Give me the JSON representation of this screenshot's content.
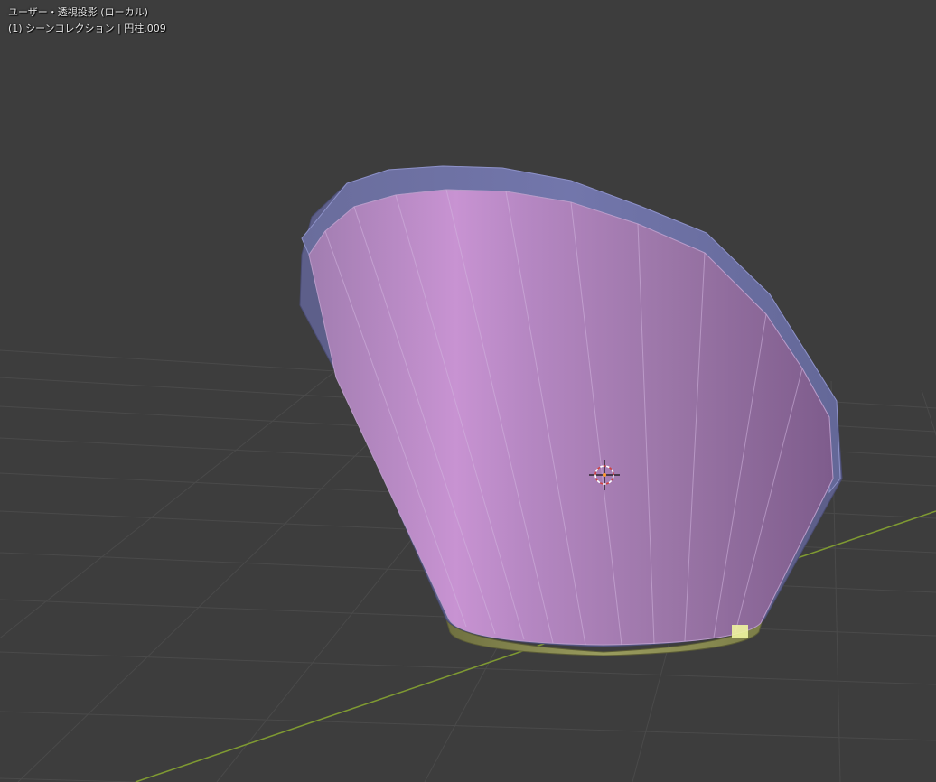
{
  "viewport": {
    "view_mode": "ユーザー・透視投影 (ローカル)",
    "collection_info": "(1) シーンコレクション | 円柱.009"
  },
  "colors": {
    "background": "#3d3d3d",
    "grid_line": "#4a4a4a",
    "x_axis": "#7f9a32",
    "mesh_face": "#a77fb0",
    "mesh_rim": "#6e72a8",
    "mesh_base": "#8a8c54",
    "selected_vertex": "#f0f5a0",
    "cursor_ring": "#d04040"
  },
  "icons": {
    "cursor": "3d-cursor-icon"
  }
}
